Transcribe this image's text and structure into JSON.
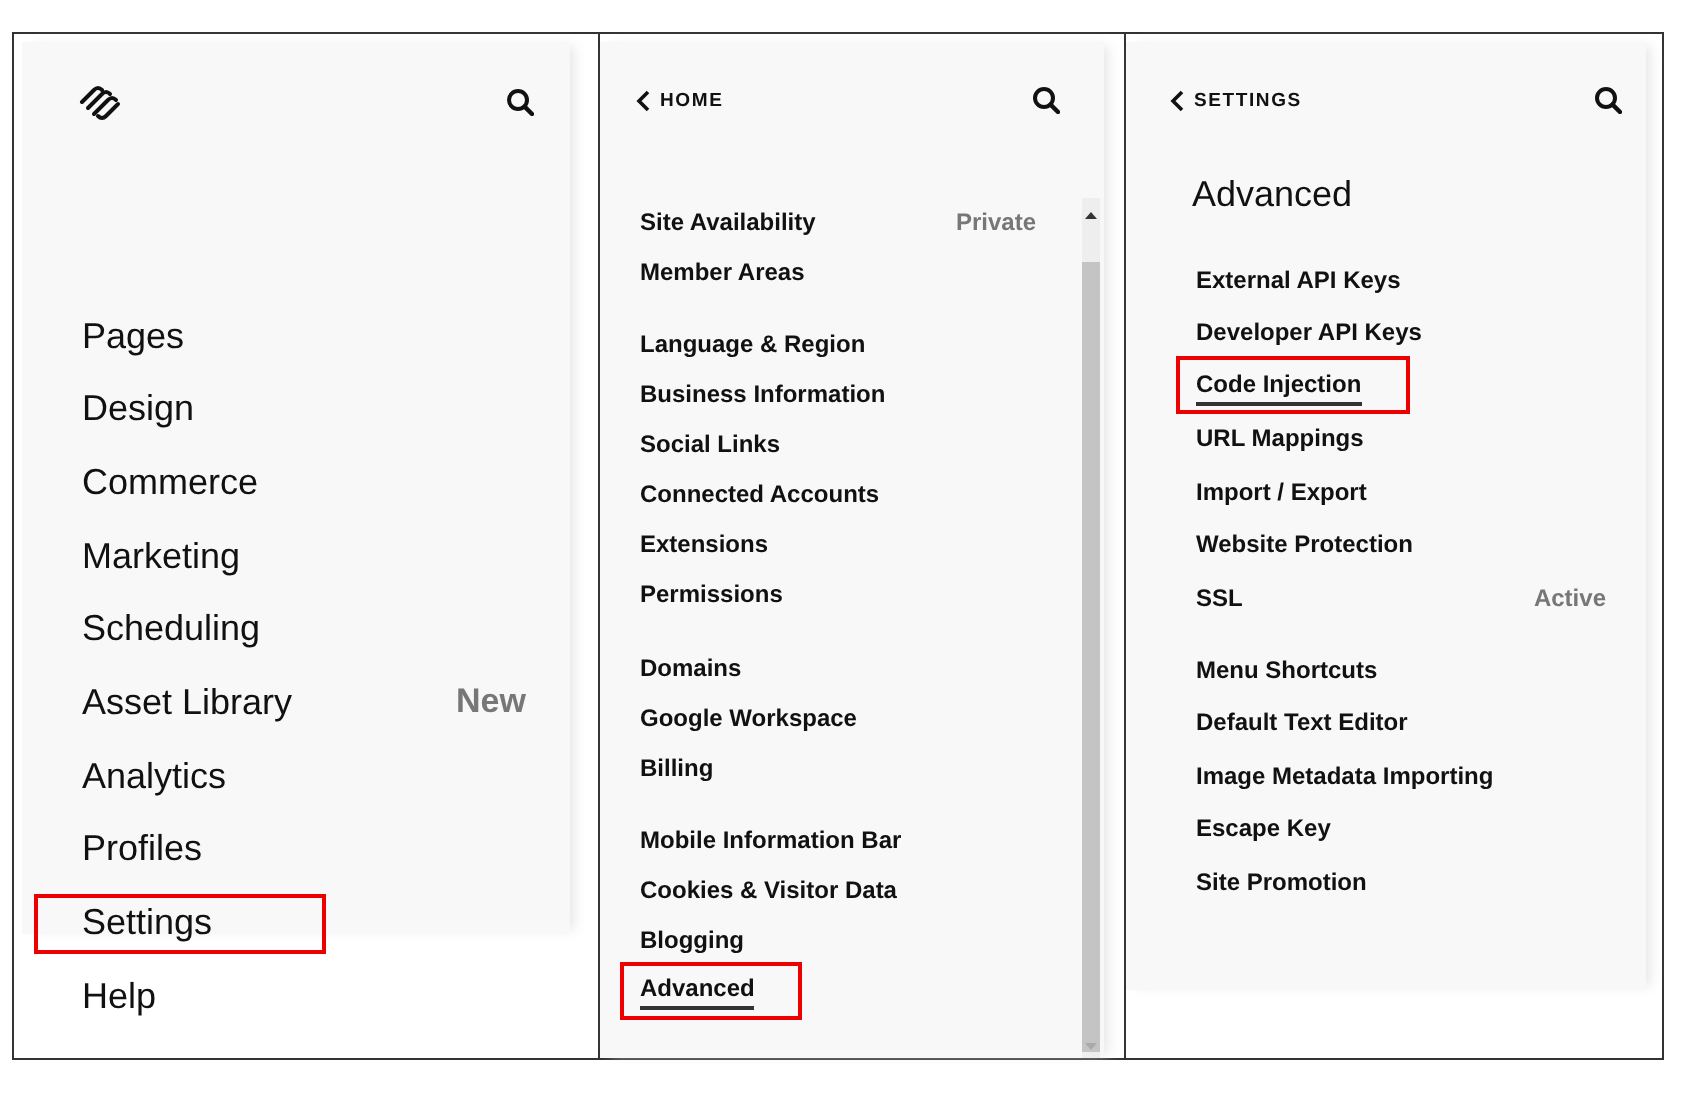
{
  "main_menu": {
    "items": [
      {
        "label": "Pages",
        "highlighted": false
      },
      {
        "label": "Design",
        "highlighted": false
      },
      {
        "label": "Commerce",
        "highlighted": false
      },
      {
        "label": "Marketing",
        "highlighted": false
      },
      {
        "label": "Scheduling",
        "highlighted": false
      },
      {
        "label": "Asset Library",
        "badge": "New",
        "highlighted": false
      },
      {
        "label": "Analytics",
        "highlighted": false
      },
      {
        "label": "Profiles",
        "highlighted": false
      },
      {
        "label": "Settings",
        "highlighted": true
      },
      {
        "label": "Help",
        "highlighted": false
      }
    ]
  },
  "settings_menu": {
    "back": "HOME",
    "groups": [
      [
        {
          "label": "Site Availability",
          "value": "Private",
          "selected": false,
          "highlighted": false
        },
        {
          "label": "Member Areas",
          "selected": false,
          "highlighted": false
        }
      ],
      [
        {
          "label": "Language & Region",
          "selected": false,
          "highlighted": false
        },
        {
          "label": "Business Information",
          "selected": false,
          "highlighted": false
        },
        {
          "label": "Social Links",
          "selected": false,
          "highlighted": false
        },
        {
          "label": "Connected Accounts",
          "selected": false,
          "highlighted": false
        },
        {
          "label": "Extensions",
          "selected": false,
          "highlighted": false
        },
        {
          "label": "Permissions",
          "selected": false,
          "highlighted": false
        }
      ],
      [
        {
          "label": "Domains",
          "selected": false,
          "highlighted": false
        },
        {
          "label": "Google Workspace",
          "selected": false,
          "highlighted": false
        },
        {
          "label": "Billing",
          "selected": false,
          "highlighted": false
        }
      ],
      [
        {
          "label": "Mobile Information Bar",
          "selected": false,
          "highlighted": false
        },
        {
          "label": "Cookies & Visitor Data",
          "selected": false,
          "highlighted": false
        },
        {
          "label": "Blogging",
          "selected": false,
          "highlighted": false
        },
        {
          "label": "Advanced",
          "selected": true,
          "highlighted": true
        }
      ]
    ]
  },
  "advanced_menu": {
    "back": "SETTINGS",
    "title": "Advanced",
    "groups": [
      [
        {
          "label": "External API Keys",
          "selected": false,
          "highlighted": false
        },
        {
          "label": "Developer API Keys",
          "selected": false,
          "highlighted": false
        },
        {
          "label": "Code Injection",
          "selected": true,
          "highlighted": true
        },
        {
          "label": "URL Mappings",
          "selected": false,
          "highlighted": false
        },
        {
          "label": "Import / Export",
          "selected": false,
          "highlighted": false
        },
        {
          "label": "Website Protection",
          "selected": false,
          "highlighted": false
        },
        {
          "label": "SSL",
          "value": "Active",
          "selected": false,
          "highlighted": false
        }
      ],
      [
        {
          "label": "Menu Shortcuts",
          "selected": false,
          "highlighted": false
        },
        {
          "label": "Default Text Editor",
          "selected": false,
          "highlighted": false
        },
        {
          "label": "Image Metadata Importing",
          "selected": false,
          "highlighted": false
        },
        {
          "label": "Escape Key",
          "selected": false,
          "highlighted": false
        },
        {
          "label": "Site Promotion",
          "selected": false,
          "highlighted": false
        }
      ]
    ]
  }
}
